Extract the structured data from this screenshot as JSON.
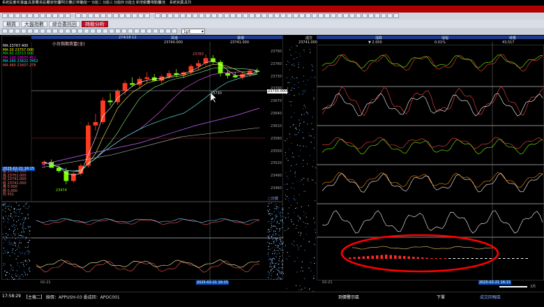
{
  "menu": [
    "系統設定",
    "分析畫面",
    "工具選項",
    "交易設定",
    "視窗管理",
    "說明文件",
    "自訂排版",
    "功能一",
    "功能二",
    "功能三",
    "功能四",
    "功能五",
    "新增報價",
    "市場動態",
    "其他",
    "系統資訊",
    "工具列"
  ],
  "tabs": [
    {
      "label": "期貨",
      "active": false
    },
    {
      "label": "大盤指數",
      "active": false
    },
    {
      "label": "綜合委託回",
      "active": false
    },
    {
      "label": "持股分析",
      "active": true
    }
  ],
  "strip": {
    "dropdown_value": "1pt"
  },
  "chart": {
    "title": "小台指期貨富(全)",
    "header_top": "274/18 12",
    "headers": [
      {
        "label": "買進",
        "value": "23740.000"
      },
      {
        "label": "賣價",
        "value": "23741.000"
      },
      {
        "label": "成交",
        "value": "23741.000"
      },
      {
        "label": "漲跌",
        "value": "▼ 2.000"
      },
      {
        "label": "漲幅",
        "value": "0.01%"
      },
      {
        "label": "總量",
        "value": "43,517"
      }
    ],
    "legend": [
      {
        "name": "MA",
        "value": "23767.400",
        "color": "#ffffff"
      },
      {
        "name": "MA 20",
        "value": "23757.000",
        "color": "#ffff00"
      },
      {
        "name": "MA 60",
        "value": "23713.000",
        "color": "#00ff00"
      },
      {
        "name": "MA 120",
        "value": "23630.411",
        "color": "#ff00ff"
      },
      {
        "name": "MA 240",
        "value": "23622.7452",
        "color": "#00ffff"
      },
      {
        "name": "MA 480",
        "value": "23607.278",
        "color": "#ff6666"
      }
    ],
    "label_high": "23783",
    "label_low": "23474",
    "label_mid": "23730",
    "label_cur": "23730.000",
    "y_ticks": [
      "23790",
      "23760",
      "23730",
      "23700",
      "23670",
      "23640",
      "23610",
      "23580",
      "23550",
      "23520",
      "23490",
      "23460"
    ],
    "date_tag": "2025-02-21 16:15",
    "side_values": [
      {
        "k": "開",
        "v": "23740.000"
      },
      {
        "k": "高",
        "v": "23751.000"
      },
      {
        "k": "低",
        "v": "23741.000"
      },
      {
        "k": "收",
        "v": "23741.000"
      },
      {
        "k": "量",
        "v": "0.000"
      },
      {
        "k": "額",
        "v": "0.000"
      },
      {
        "k": "均",
        "v": "551"
      }
    ],
    "legend_btn": "□分價",
    "x_left": "02-21",
    "x_right": "2025-02-21 16:15",
    "x_right2": "2025-02-21 16:15",
    "x_far": "3月"
  },
  "chart_data": {
    "type": "candlestick",
    "ylim": [
      23440,
      23800
    ],
    "candles": [
      [
        23520,
        23528,
        23512,
        23524
      ],
      [
        23524,
        23530,
        23515,
        23510
      ],
      [
        23510,
        23516,
        23498,
        23502
      ],
      [
        23502,
        23510,
        23470,
        23478
      ],
      [
        23478,
        23500,
        23474,
        23496
      ],
      [
        23496,
        23520,
        23490,
        23515
      ],
      [
        23515,
        23620,
        23510,
        23612
      ],
      [
        23612,
        23640,
        23600,
        23620
      ],
      [
        23620,
        23680,
        23615,
        23672
      ],
      [
        23672,
        23690,
        23660,
        23668
      ],
      [
        23668,
        23700,
        23662,
        23695
      ],
      [
        23695,
        23720,
        23685,
        23714
      ],
      [
        23714,
        23728,
        23705,
        23710
      ],
      [
        23710,
        23730,
        23700,
        23724
      ],
      [
        23724,
        23740,
        23715,
        23728
      ],
      [
        23728,
        23736,
        23720,
        23720
      ],
      [
        23720,
        23735,
        23712,
        23730
      ],
      [
        23730,
        23745,
        23724,
        23738
      ],
      [
        23738,
        23748,
        23728,
        23734
      ],
      [
        23734,
        23742,
        23726,
        23740
      ],
      [
        23740,
        23760,
        23735,
        23755
      ],
      [
        23755,
        23770,
        23745,
        23762
      ],
      [
        23762,
        23783,
        23756,
        23774
      ],
      [
        23774,
        23782,
        23760,
        23765
      ],
      [
        23765,
        23770,
        23730,
        23738
      ],
      [
        23738,
        23745,
        23725,
        23732
      ],
      [
        23732,
        23740,
        23726,
        23728
      ],
      [
        23728,
        23740,
        23722,
        23736
      ],
      [
        23736,
        23748,
        23730,
        23744
      ],
      [
        23744,
        23750,
        23738,
        23741
      ]
    ]
  },
  "status": {
    "time": "17:58:29",
    "text": "【主機二】 線價：APPUSH-03 委成回：APOC001",
    "btn1": "到價警示區",
    "btn2": "下單",
    "btn3": "成交回報區"
  },
  "colors": {
    "up": "#ff3b1f",
    "down": "#7cfc00",
    "annotation": "#ff0000",
    "accent": "#b00000"
  }
}
